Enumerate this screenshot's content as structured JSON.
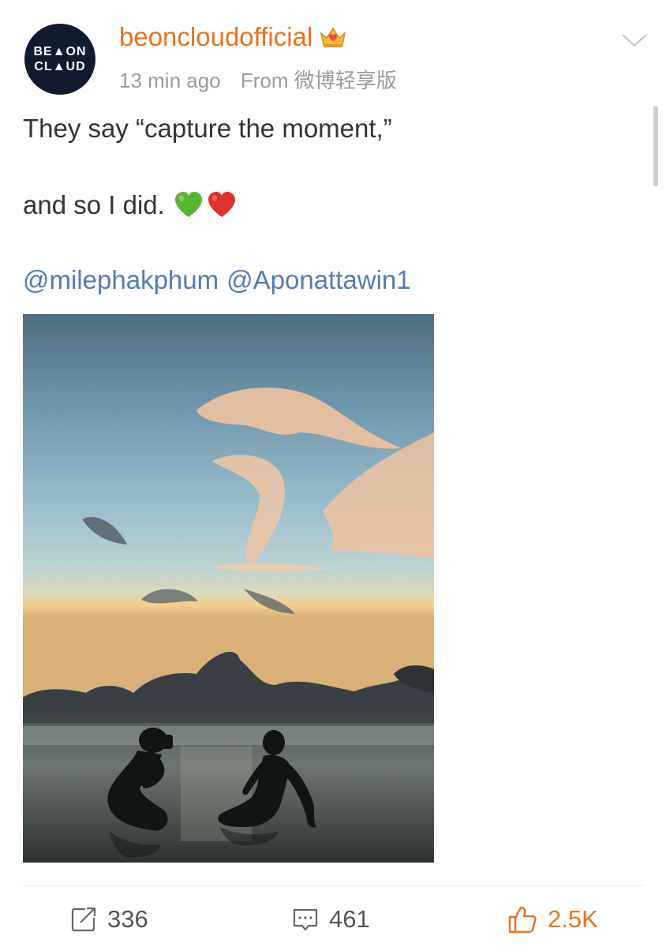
{
  "post": {
    "avatar": {
      "line1": "BE▲ON",
      "line2": "CL▲UD",
      "icon": "brand-logo"
    },
    "username": "beoncloudofficial",
    "badge_icon": "crown-badge-icon",
    "time": "13 min ago",
    "source": "From 微博轻享版",
    "menu_icon": "chevron-down-icon",
    "text_line1": "They say “capture the moment,”",
    "text_line2": "and so I did.",
    "emojis": [
      "green-heart",
      "red-heart"
    ],
    "mentions": [
      "@milephakphum",
      "@Aponattawin1"
    ],
    "image": "silhouettes-on-beach-at-sunset-photo"
  },
  "actions": {
    "share_count": "336",
    "comment_count": "461",
    "like_count": "2.5K"
  },
  "colors": {
    "accent": "#e8731c",
    "link": "#4f7eb4",
    "muted": "#9b9b9b",
    "text": "#333333"
  }
}
